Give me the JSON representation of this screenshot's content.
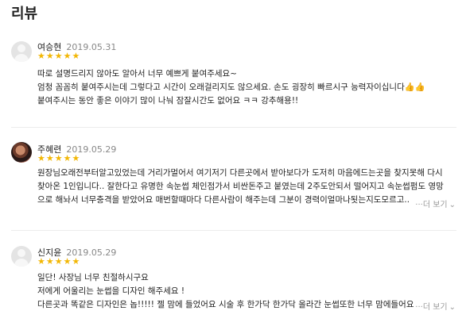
{
  "section_title": "리뷰",
  "reviews": [
    {
      "name": "여승현",
      "date": "2019.05.31",
      "stars": "★★★★★",
      "lines": [
        "따로 설명드리지 않아도 알아서 너무 예쁘게 붙여주세요~",
        "엄청 꼼꼼히 붙여주시는데 그렇다고 시간이 오래걸리지도 않으세요. 손도 굉장히 빠르시구 능력자이십니다👍👍",
        "붙여주시는 동안 좋은 이야기 많이 나눠 잠잘시간도 없어요 ㅋㅋ 강추해용!!"
      ],
      "more": ""
    },
    {
      "name": "주혜련",
      "date": "2019.05.29",
      "stars": "★★★★★",
      "lines": [
        "원장님오래전부터알고있었는데 거리가멀어서 여기저기 다른곳에서 받아보다가 도저히 마음에드는곳을 찾지못해 다시",
        "찾아온 1인입니다.. 잘한다고 유명한 속눈썹 체인점가서 비싼돈주고 붙였는데 2주도안되서 떨어지고 속눈썹펌도 영망",
        "으로 해놔서 너무충격을 받았어요 매번할때마다 다른사람이 해주는데 그분이 경력이얼마나됫는지도모르고.."
      ],
      "more": "···더 보기"
    },
    {
      "name": "신지윤",
      "date": "2019.05.29",
      "stars": "★★★★★",
      "lines": [
        "일단! 사장님 너무 친절하시구요",
        "저에게 어울리는 눈썹을 디자인 해주세요 !",
        "다른곳과 똑같은 디자인은 놉!!!!! 젤 맘에 들었어요 시술 후 한가닥 한가닥 올라간 눈썹또한 너무 맘에들어요"
      ],
      "more": "···더 보기"
    }
  ]
}
